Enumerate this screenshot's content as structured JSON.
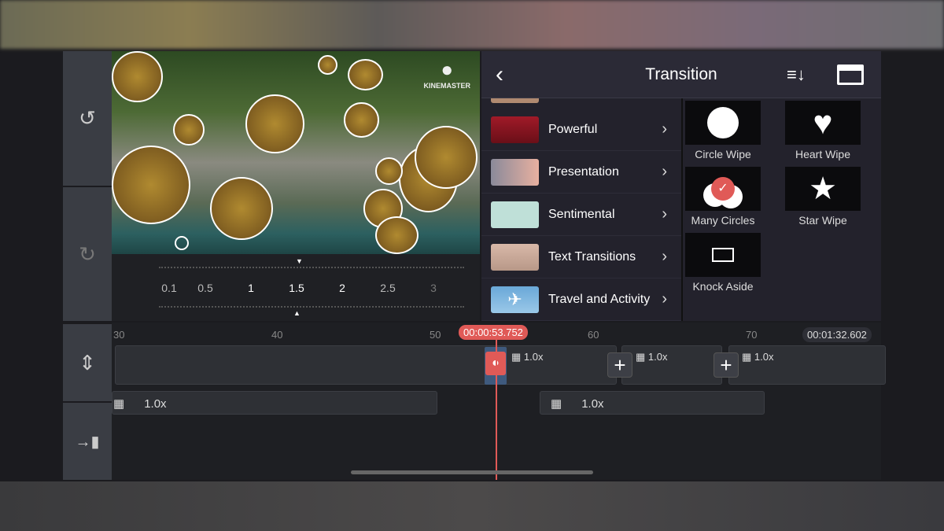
{
  "preview": {
    "watermark": "KINEMASTER"
  },
  "sidebar": {
    "undo_icon": "undo-icon",
    "redo_icon": "redo-icon",
    "adjust_icon": "track-height-icon",
    "export_icon": "jump-to-end-icon"
  },
  "speed_scale": {
    "ticks": [
      "0.1",
      "0.5",
      "1",
      "1.5",
      "2",
      "2.5",
      "3"
    ],
    "selected": "1.5"
  },
  "panel": {
    "title": "Transition",
    "sort_icon": "sort-icon",
    "store_icon": "store-icon",
    "categories": [
      {
        "label": "Powerful"
      },
      {
        "label": "Presentation"
      },
      {
        "label": "Sentimental"
      },
      {
        "label": "Text Transitions"
      },
      {
        "label": "Travel and Activity"
      }
    ],
    "transitions": [
      {
        "label": "Circle Wipe"
      },
      {
        "label": "Heart Wipe"
      },
      {
        "label": "Many Circles",
        "selected": true
      },
      {
        "label": "Star Wipe"
      },
      {
        "label": "Knock Aside"
      }
    ]
  },
  "timeline": {
    "ruler": [
      "30",
      "40",
      "50",
      "60",
      "70"
    ],
    "playhead_time": "00:00:53.752",
    "total_time": "00:01:32.602",
    "clip_speeds": [
      "1.0x",
      "1.0x",
      "1.0x"
    ],
    "audio_speeds": [
      "1.0x",
      "1.0x"
    ]
  },
  "colors": {
    "accent": "#e05a57",
    "panel": "#23222c"
  }
}
